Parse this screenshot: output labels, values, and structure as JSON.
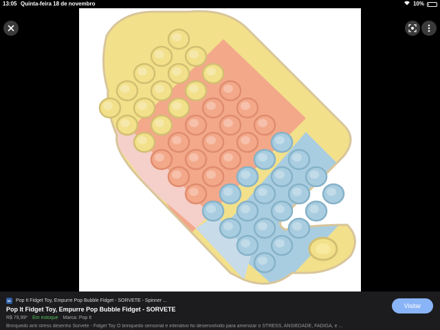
{
  "status_bar": {
    "time": "13:05",
    "date": "Quinta-feira 18 de novembro",
    "battery_percent_label": "10%",
    "battery_level": 0.1,
    "icons": [
      "wifi-icon",
      "battery-icon"
    ]
  },
  "viewer": {
    "close_icon": "close-icon",
    "lens_icon": "lens-icon",
    "more_icon": "more-vert-icon",
    "image_alt": "popsicle-shaped pop-it fidget toy in yellow, peach and blue"
  },
  "result": {
    "favicon_text": "ML",
    "source": "Pop It Fidget Toy, Empurre Pop Bubble Fidget - SORVETE - Spinner ...",
    "title": "Pop It Fidget Toy, Empurre Pop Bubble Fidget - SORVETE",
    "price": "R$ 79,99*",
    "stock": "Em estoque",
    "brand": "Marca: Pop It",
    "description": "Brinquedo anti stress desenho Sorvete - Fidget Toy O brinquedo sensorial e interativo foi desenvolvido para amenizar o STRESS, ANSIEDADE, FADIGA, e ...",
    "visit_label": "Visitar"
  },
  "colors": {
    "yellow": "#f2e08a",
    "peach": "#f3a88a",
    "blue": "#a9cde0",
    "pink": "#f5cfc9",
    "visit_button": "#8ab4f8",
    "stock_green": "#55c05a"
  }
}
